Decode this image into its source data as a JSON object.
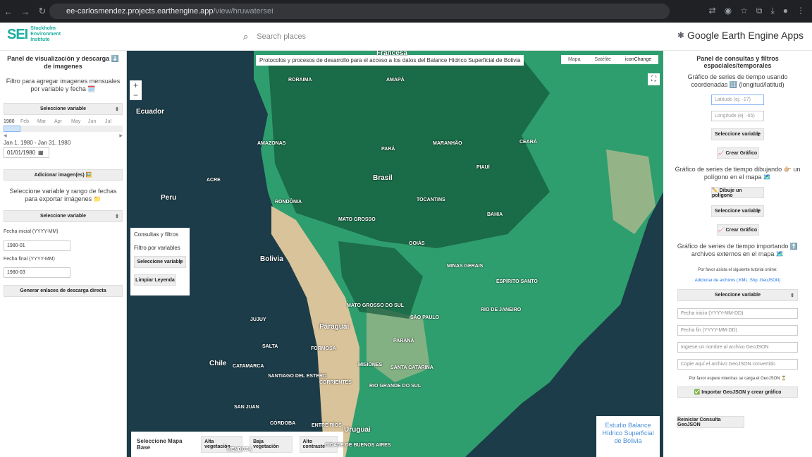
{
  "browser": {
    "url_domain": "ee-carlosmendez.projects.earthengine.app",
    "url_path": "/view/hruwatersei"
  },
  "header": {
    "logo_text": "SEI",
    "logo_org_line1": "Stockholm",
    "logo_org_line2": "Environment",
    "logo_org_line3": "Institute",
    "search_placeholder": "Search places",
    "gee_title": "Google Earth Engine Apps"
  },
  "left": {
    "title": "Panel de visualización y descarga ⬇️ de imagenes",
    "filter_text": "Filtro para agregar imagenes mensuales por variable y fecha 🗓️",
    "select_variable_1": "Seleccione variable",
    "timeline": [
      "1980",
      "Feb",
      "Mar",
      "Apr",
      "May",
      "Jun",
      "Jul"
    ],
    "date_range": "Jan 1, 1980 - Jan 31, 1980",
    "date_value": "01/01/1980",
    "add_images_btn": "Adicionar imagen(es) 🖼️",
    "export_text": "Seleccione variable y rango de fechas para exportar imágenes 📁",
    "select_variable_2": "Seleccione variable",
    "start_label": "Fecha inicial (YYYY-MM)",
    "start_value": "1980-01",
    "end_label": "Fecha final (YYYY-MM)",
    "end_value": "1980-03",
    "download_btn": "Generar enlaces de descarga directa"
  },
  "map": {
    "title_banner": "Protocolos y procesos de desarrollo para el acceso a los datos del Balance Hídrico Superficial de Bolivia",
    "map_types": [
      "Mapa",
      "Satélite",
      "iconChange"
    ],
    "zoom_in": "+",
    "zoom_out": "−",
    "consultas": "Consultas y filtros",
    "filtro": "Filtro por variables",
    "select_variable": "Seleccione variable",
    "limpiar_btn": "Limpiar Leyenda",
    "base_map_label": "Seleccione Mapa Base",
    "base_buttons": [
      "Alta vegetación",
      "Baja vegetación",
      "Alto contraste"
    ],
    "study_title": "Estudio Balance Hídrico Superficial de Bolivia",
    "labels": [
      {
        "t": "Francesa",
        "big": true
      },
      {
        "t": "AMAPÁ"
      },
      {
        "t": "RORAIMA"
      },
      {
        "t": "Ecuador",
        "big": true
      },
      {
        "t": "PARÁ"
      },
      {
        "t": "AMAZONAS"
      },
      {
        "t": "MARANHÃO"
      },
      {
        "t": "CEARÁ"
      },
      {
        "t": "Brasil",
        "big": true
      },
      {
        "t": "PIAUÍ"
      },
      {
        "t": "ACRE"
      },
      {
        "t": "Peru",
        "big": true
      },
      {
        "t": "RONDÔNIA"
      },
      {
        "t": "TOCANTINS"
      },
      {
        "t": "BAHIA"
      },
      {
        "t": "MATO GROSSO"
      },
      {
        "t": "GOIÁS"
      },
      {
        "t": "Bolivia",
        "big": true
      },
      {
        "t": "MINAS GERAIS"
      },
      {
        "t": "ESPÍRITO SANTO"
      },
      {
        "t": "MATO GROSSO DO SUL"
      },
      {
        "t": "RIO DE JANEIRO"
      },
      {
        "t": "SÃO PAULO"
      },
      {
        "t": "JUJUY"
      },
      {
        "t": "Paraguai",
        "big": true
      },
      {
        "t": "PARANÁ"
      },
      {
        "t": "SALTA"
      },
      {
        "t": "FORMOSA"
      },
      {
        "t": "Chile",
        "big": true
      },
      {
        "t": "CATAMARCA"
      },
      {
        "t": "MISIONES"
      },
      {
        "t": "SANTA CATARINA"
      },
      {
        "t": "SANTIAGO DEL ESTERO"
      },
      {
        "t": "CORRIENTES"
      },
      {
        "t": "RIO GRANDE DO SUL"
      },
      {
        "t": "SAN JUAN"
      },
      {
        "t": "CÓRDOBA"
      },
      {
        "t": "ENTRE RÍOS"
      },
      {
        "t": "Uruguai",
        "big": true
      },
      {
        "t": "MENDOZA"
      },
      {
        "t": "CIDADE DE BUENOS AIRES"
      }
    ]
  },
  "right": {
    "title": "Panel de consultas y filtros espaciales/temporales",
    "coord_text": "Gráfico de series de tiempo usando coordenadas 🔢 (longitud/latitud)",
    "lat_placeholder": "Latitude (ej. -17)",
    "lon_placeholder": "Longitude (ej. -65)",
    "select_variable_1": "Seleccione variable",
    "crear_grafico_1": "📈 Crear Gráfico",
    "polygon_text": "Gráfico de series de tiempo dibujando 👉🏼 un polígono en el mapa 🗺️",
    "dibuje_btn": "✏️ Dibuje un polígono",
    "select_variable_2": "Seleccione variable",
    "crear_grafico_2": "📈 Crear Gráfico",
    "import_text": "Gráfico de series de tiempo importando ⬆️ archivos externos en el mapa 🗺️",
    "tutorial_text": "Por favor asista el siguiente tutorial online:",
    "tutorial_link": "Adicionar de archivos (.KML .Shp .GeoJSON)",
    "select_variable_3": "Seleccione variable",
    "fecha_inicio": "Fecha inicio (YYYY-MM-DD)",
    "fecha_fin": "Fecha fin (YYYY-MM-DD)",
    "nombre_archivo": "Ingrese un nombre al archivo GeoJSON",
    "copie_archivo": "Copie aquí el archivo GeoJSON convertido",
    "espere_text": "Por favor espere mientras se carga el GeoJSON ⏳",
    "importar_btn": "✅ Importar GeoJSON y crear gráfico",
    "reiniciar_btn": "Reiniciar Consulta GeoJSON"
  },
  "colors": {
    "forest": "#1f7a54",
    "vegetation": "#2f9e6e",
    "arid": "#d9c39a",
    "ocean": "#1b3c48",
    "accent": "#1aae9f"
  }
}
